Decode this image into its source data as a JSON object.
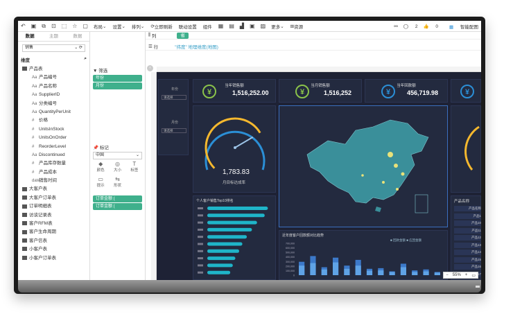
{
  "toolbar": {
    "items": [
      "布局",
      "设置",
      "排列",
      "立即刷新",
      "联动设置",
      "组件",
      "更多",
      "资源"
    ],
    "right": {
      "share": "",
      "comments": "2",
      "likes": "0",
      "smart": "智能配图"
    }
  },
  "data_panel": {
    "tabs": [
      "数据",
      "主题",
      "数据"
    ],
    "dataset": "销售",
    "section_title": "维度",
    "main_table": "产品表",
    "fields": [
      {
        "type": "Aa",
        "name": "产品编号"
      },
      {
        "type": "Aa",
        "name": "产品名称"
      },
      {
        "type": "Aa",
        "name": "SupplierID"
      },
      {
        "type": "Aa",
        "name": "分类编号"
      },
      {
        "type": "Aa",
        "name": "QuantityPerUnit"
      },
      {
        "type": "#",
        "name": "价格"
      },
      {
        "type": "#",
        "name": "UnitsInStock"
      },
      {
        "type": "#",
        "name": "UnitsOnOrder"
      },
      {
        "type": "#",
        "name": "ReorderLevel"
      },
      {
        "type": "Aa",
        "name": "Discontinued"
      },
      {
        "type": "#",
        "name": "产品库存数量"
      },
      {
        "type": "#",
        "name": "产品成本"
      },
      {
        "type": "date",
        "name": "销售时间"
      }
    ],
    "tables": [
      "大客户表",
      "大客户订单表",
      "订单明细表",
      "访谈记录表",
      "客户RFM表",
      "客户生命周期",
      "客户信表",
      "小客户表",
      "小客户订单表"
    ]
  },
  "mid_panel": {
    "filter_label": "筛选",
    "filter_pills": [
      "年份",
      "月份"
    ],
    "marks_label": "标记",
    "marks_select": "中国",
    "marks": [
      {
        "icon": "◆",
        "label": "颜色"
      },
      {
        "icon": "◎",
        "label": "大小"
      },
      {
        "icon": "T",
        "label": "标签"
      },
      {
        "icon": "▭",
        "label": "提示"
      },
      {
        "icon": "⇆",
        "label": "形状"
      }
    ],
    "mark_pills": [
      "订单金额 (",
      "订单金额 ("
    ]
  },
  "shelf": {
    "columns_label": "列",
    "columns_pill": "省",
    "rows_label": "行",
    "rows_hint": "\"纬度\" 地理维度(地图)"
  },
  "dashboard": {
    "filters": [
      {
        "label": "年份",
        "value": "请选择"
      },
      {
        "label": "月份",
        "value": "请选择"
      }
    ],
    "kpis": [
      {
        "title": "当年销售额",
        "value": "1,516,252.00",
        "color": "#8bc34a"
      },
      {
        "title": "当月销售额",
        "value": "1,516,252",
        "color": "#8bc34a"
      },
      {
        "title": "当年回款额",
        "value": "456,719.98",
        "color": "#2b8fd6"
      },
      {
        "title": "",
        "value": "",
        "color": "#2b8fd6"
      }
    ],
    "gauge": {
      "value_text": "1,783.83",
      "label": "月目标达成率",
      "fraction": 0.72
    },
    "bar_chart_title": "个人客户销售Top10排名",
    "bar_values": [
      0.95,
      0.9,
      0.78,
      0.7,
      0.62,
      0.55,
      0.5,
      0.44,
      0.4,
      0.36
    ],
    "col_chart_title": "近年度客户回款额对比趋势",
    "col_chart_legend": [
      "回款金额",
      "应回金额"
    ],
    "col_y_ticks": [
      "700,000",
      "600,000",
      "500,000",
      "400,000",
      "300,000",
      "200,000",
      "100,000",
      "0"
    ],
    "col_values_a": [
      0.42,
      0.6,
      0.25,
      0.55,
      0.3,
      0.48,
      0.2,
      0.22,
      0.12,
      0.36,
      0.15,
      0.18,
      0.1
    ],
    "col_values_b": [
      0.3,
      0.38,
      0.18,
      0.4,
      0.2,
      0.3,
      0.14,
      0.15,
      0.1,
      0.25,
      0.1,
      0.12,
      0.08
    ],
    "side_header": "产品名称",
    "side_rows": [
      "产品名称",
      "产品1",
      "产品10",
      "产品11",
      "产品12",
      "产品13",
      "产品14",
      "产品15",
      "产品16",
      "产品17"
    ],
    "zoom": "55%"
  }
}
